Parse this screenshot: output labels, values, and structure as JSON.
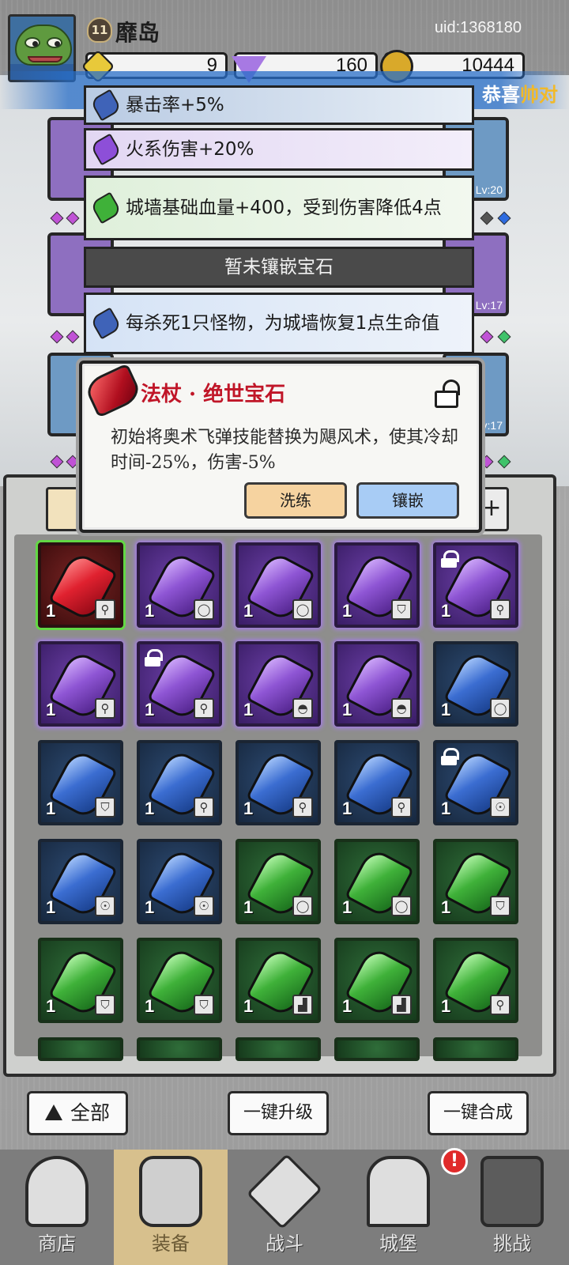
{
  "header": {
    "level": "11",
    "player_name": "靡岛",
    "uid": "uid:1368180",
    "currencies": [
      {
        "icon": "gold-gem-icon",
        "value": "9"
      },
      {
        "icon": "diamond-icon",
        "value": "160"
      },
      {
        "icon": "coin-icon",
        "value": "10444"
      }
    ]
  },
  "broadcast": {
    "prefix": "恭喜",
    "highlight": "帅对"
  },
  "equip_levels": {
    "right_1": "Lv:20",
    "right_2": "Lv:17",
    "right_3": "Lv:17"
  },
  "gem_effects": [
    {
      "color": "blue",
      "text": "暴击率+5%"
    },
    {
      "color": "purple",
      "text": "火系伤害+20%"
    },
    {
      "color": "green",
      "text": "城墙基础血量+400，受到伤害降低4点"
    },
    {
      "color": "empty",
      "text": "暂未镶嵌宝石"
    },
    {
      "color": "blue",
      "text": "每杀死1只怪物，为城墙恢复1点生命值"
    }
  ],
  "popup": {
    "title": "法杖 · 绝世宝石",
    "description": "初始将奥术飞弹技能替换为飓风术，使其冷却时间-25%，伤害-5%",
    "refine_label": "洗练",
    "inlay_label": "镶嵌"
  },
  "inventory": {
    "plus_label": "+",
    "slots": [
      {
        "rarity": "red",
        "qty": "1",
        "type": "staff",
        "locked": false,
        "selected": true
      },
      {
        "rarity": "purple",
        "qty": "1",
        "type": "ring",
        "locked": false
      },
      {
        "rarity": "purple",
        "qty": "1",
        "type": "ring",
        "locked": false
      },
      {
        "rarity": "purple",
        "qty": "1",
        "type": "armor",
        "locked": false
      },
      {
        "rarity": "purple",
        "qty": "1",
        "type": "staff",
        "locked": true
      },
      {
        "rarity": "purple",
        "qty": "1",
        "type": "staff",
        "locked": false
      },
      {
        "rarity": "purple",
        "qty": "1",
        "type": "staff",
        "locked": true
      },
      {
        "rarity": "purple",
        "qty": "1",
        "type": "helmet",
        "locked": false
      },
      {
        "rarity": "purple",
        "qty": "1",
        "type": "helmet",
        "locked": false
      },
      {
        "rarity": "blue",
        "qty": "1",
        "type": "ring",
        "locked": false
      },
      {
        "rarity": "blue",
        "qty": "1",
        "type": "armor",
        "locked": false
      },
      {
        "rarity": "blue",
        "qty": "1",
        "type": "staff",
        "locked": false
      },
      {
        "rarity": "blue",
        "qty": "1",
        "type": "staff",
        "locked": false
      },
      {
        "rarity": "blue",
        "qty": "1",
        "type": "staff",
        "locked": false
      },
      {
        "rarity": "blue",
        "qty": "1",
        "type": "necklace",
        "locked": true
      },
      {
        "rarity": "blue",
        "qty": "1",
        "type": "necklace",
        "locked": false
      },
      {
        "rarity": "blue",
        "qty": "1",
        "type": "necklace",
        "locked": false
      },
      {
        "rarity": "green",
        "qty": "1",
        "type": "ring",
        "locked": false
      },
      {
        "rarity": "green",
        "qty": "1",
        "type": "ring",
        "locked": false
      },
      {
        "rarity": "green",
        "qty": "1",
        "type": "armor",
        "locked": false
      },
      {
        "rarity": "green",
        "qty": "1",
        "type": "armor",
        "locked": false
      },
      {
        "rarity": "green",
        "qty": "1",
        "type": "armor",
        "locked": false
      },
      {
        "rarity": "green",
        "qty": "1",
        "type": "boots",
        "locked": false
      },
      {
        "rarity": "green",
        "qty": "1",
        "type": "boots",
        "locked": false
      },
      {
        "rarity": "green",
        "qty": "1",
        "type": "staff",
        "locked": false
      }
    ]
  },
  "actions": {
    "all_label": "全部",
    "upgrade_label": "一键升级",
    "merge_label": "一键合成"
  },
  "nav": [
    {
      "label": "商店",
      "icon": "shop-icon",
      "active": false
    },
    {
      "label": "装备",
      "icon": "backpack-icon",
      "active": true
    },
    {
      "label": "战斗",
      "icon": "crossed-swords-icon",
      "active": false
    },
    {
      "label": "城堡",
      "icon": "castle-icon",
      "active": false
    },
    {
      "label": "挑战",
      "icon": "challenge-icon",
      "active": false
    }
  ],
  "nav_alert": "!"
}
